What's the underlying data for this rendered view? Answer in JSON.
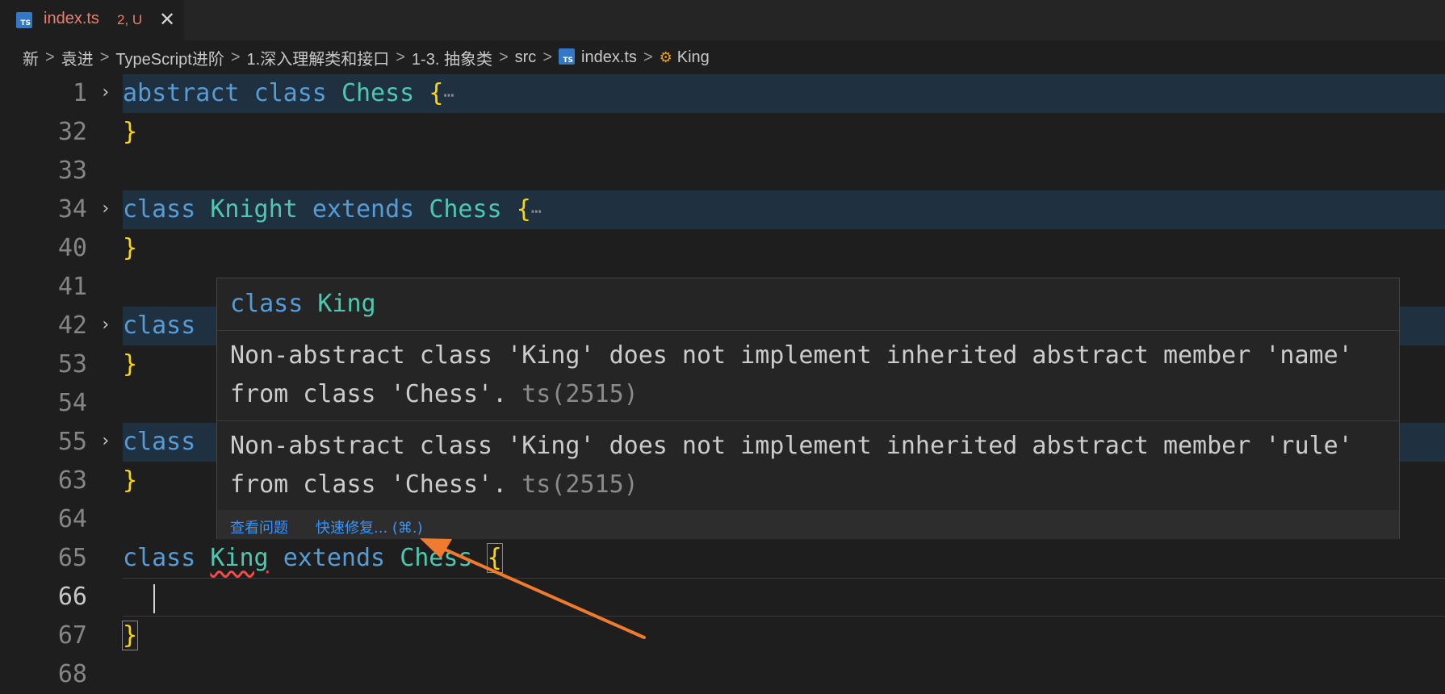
{
  "tab": {
    "filename": "index.ts",
    "badge": "2, U",
    "icon": "typescript-file-icon",
    "close": "✕"
  },
  "breadcrumb": {
    "items": [
      "新",
      "袁进",
      "TypeScript进阶",
      "1.深入理解类和接口",
      "1-3. 抽象类",
      "src",
      "index.ts",
      "King"
    ],
    "separator": ">"
  },
  "editor": {
    "lines": [
      {
        "num": "1",
        "folded": true
      },
      {
        "num": "32"
      },
      {
        "num": "33"
      },
      {
        "num": "34",
        "folded": true
      },
      {
        "num": "40"
      },
      {
        "num": "41"
      },
      {
        "num": "42",
        "folded": true
      },
      {
        "num": "53"
      },
      {
        "num": "54"
      },
      {
        "num": "55",
        "folded": true
      },
      {
        "num": "63"
      },
      {
        "num": "64"
      },
      {
        "num": "65"
      },
      {
        "num": "66",
        "active": true
      },
      {
        "num": "67"
      },
      {
        "num": "68"
      }
    ],
    "tokens": {
      "abstract": "abstract",
      "class": "class",
      "extends": "extends",
      "chess": "Chess",
      "knight": "Knight",
      "king": "King",
      "open_brace": "{",
      "close_brace": "}",
      "ellipsis": "⋯",
      "fold_chevron": "›"
    }
  },
  "hover": {
    "title_keyword": "class",
    "title_name": "King",
    "messages": [
      {
        "text": "Non-abstract class 'King' does not implement inherited abstract member 'name' from class 'Chess'.",
        "code": "ts(2515)"
      },
      {
        "text": "Non-abstract class 'King' does not implement inherited abstract member 'rule' from class 'Chess'.",
        "code": "ts(2515)"
      }
    ],
    "actions": {
      "view_problem": "查看问题",
      "quick_fix": "快速修复... (⌘.)"
    }
  },
  "colors": {
    "keyword": "#569cd6",
    "class_name": "#4ec9b0",
    "brace": "#ffd700",
    "link": "#3794ff",
    "arrow": "#f07b2e",
    "tab_modified": "#e8806f"
  }
}
